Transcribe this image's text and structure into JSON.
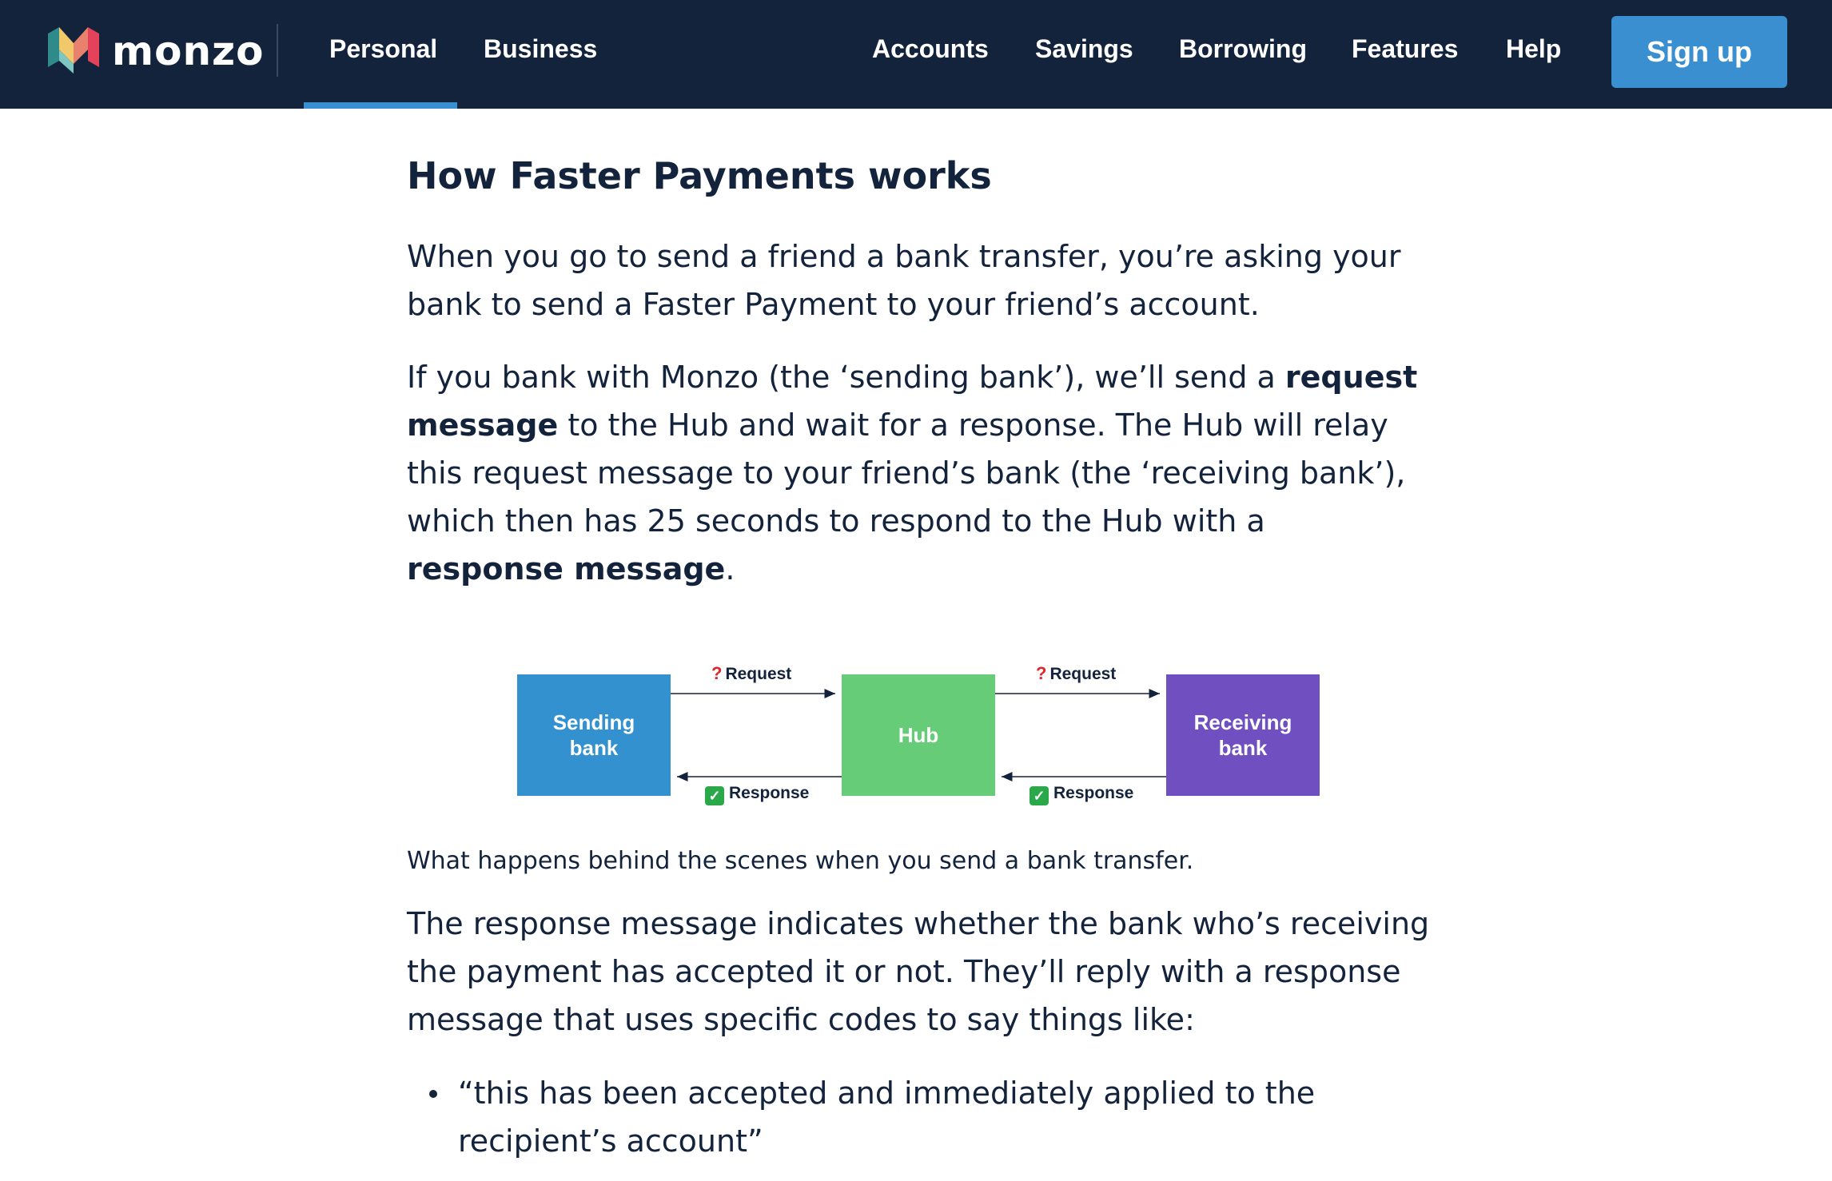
{
  "nav": {
    "brand": "monzo",
    "segments": [
      {
        "label": "Personal"
      },
      {
        "label": "Business"
      }
    ],
    "links": [
      {
        "label": "Accounts"
      },
      {
        "label": "Savings"
      },
      {
        "label": "Borrowing"
      },
      {
        "label": "Features"
      },
      {
        "label": "Help"
      }
    ],
    "cta": "Sign up",
    "colors": {
      "bar": "#14233c",
      "accent": "#3a8fd1"
    }
  },
  "article": {
    "heading": "How Faster Payments works",
    "p1": "When you go to send a friend a bank transfer, you’re asking your bank to send a Faster Payment to your friend’s account.",
    "p2": {
      "a": "If you bank with Monzo (the ‘sending bank’), we’ll send a ",
      "b": "request message",
      "c": " to the Hub and wait for a response. The Hub will relay this request message to your friend’s bank (the ‘receiving bank’), which then has 25 seconds to respond to the Hub with a ",
      "d": "response message",
      "e": "."
    },
    "caption": "What happens behind the scenes when you send a bank transfer.",
    "p3": "The response message indicates whether the bank who’s receiving the payment has accepted it or not. They’ll reply with a response message that uses specific codes to say things like:",
    "bullets": [
      "“this has been accepted and immediately applied to the recipient’s account”"
    ]
  },
  "diagram": {
    "sending": "Sending bank",
    "hub": "Hub",
    "receiving": "Receiving bank",
    "request": "Request",
    "response": "Response",
    "colors": {
      "sending": "#3391cf",
      "hub": "#66cc77",
      "receiving": "#7050c0"
    }
  }
}
